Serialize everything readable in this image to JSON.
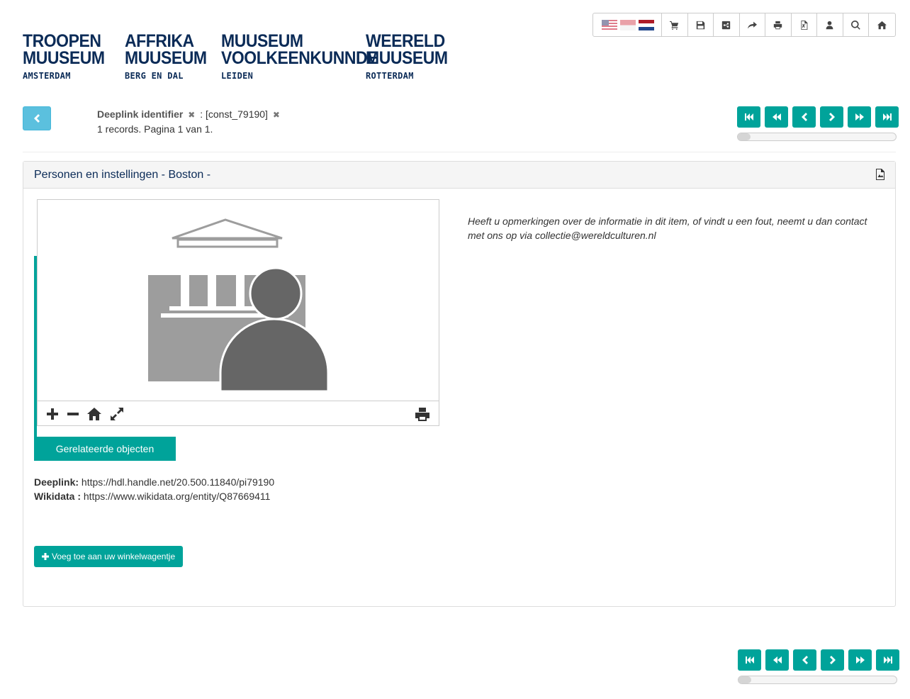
{
  "toolbar": {
    "flags": [
      "us-flag-icon",
      "id-flag-icon",
      "nl-flag-icon"
    ],
    "buttons": [
      "cart-icon",
      "save-icon",
      "share-icon",
      "forward-icon",
      "print-icon",
      "excel-icon",
      "user-icon",
      "search-icon",
      "home-icon"
    ]
  },
  "logos": [
    {
      "line1": "TROOPEN",
      "line2": "MUUSEUM",
      "line3": "AMSTERDAM"
    },
    {
      "line1": "AFFRIKA",
      "line2": "MUUSEUM",
      "line3": "BERG EN DAL"
    },
    {
      "line1": "MUUSEUM",
      "line2": "VOOLKEENKUNNDE",
      "line3": "LEIDEN"
    },
    {
      "line1": "WEERELD",
      "line2": "MUUSEUM",
      "line3": "ROTTERDAM"
    }
  ],
  "search": {
    "field_label": "Deeplink identifier",
    "separator": ": [const_79190]",
    "records_text": "1 records. Pagina 1 van 1."
  },
  "pager": {
    "progress_fraction": 0.08
  },
  "panel": {
    "title": "Personen en instellingen - Boston -",
    "related_button": "Gerelateerde objecten",
    "note": "Heeft u opmerkingen over de informatie in dit item, of vindt u een fout, neemt u dan contact met ons op via collectie@wereldculturen.nl",
    "deeplink_label": "Deeplink:",
    "deeplink_value": "https://hdl.handle.net/20.500.11840/pi79190",
    "wikidata_label": "Wikidata :",
    "wikidata_value": "https://www.wikidata.org/entity/Q87669411",
    "cart_button": "Voeg toe aan uw winkelwagentje"
  },
  "colors": {
    "teal": "#00a39a",
    "info_blue": "#5bc0de",
    "navy": "#0b2b57"
  }
}
